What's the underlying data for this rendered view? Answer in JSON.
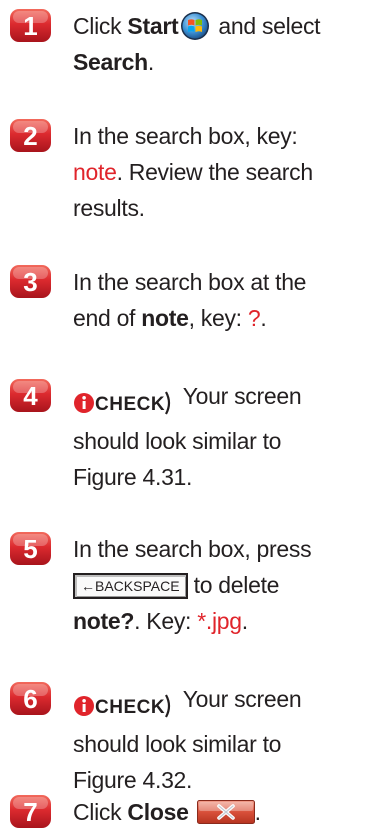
{
  "steps": [
    {
      "number": "1",
      "lines": [
        {
          "a": "Click ",
          "b": "Start",
          "c": " and select"
        },
        {
          "b": "Search",
          "c": "."
        }
      ]
    },
    {
      "number": "2",
      "lines": [
        {
          "a": "In the search box, key:"
        },
        {
          "red": "note",
          "c": ". Review the search"
        },
        {
          "a": "results."
        }
      ]
    },
    {
      "number": "3",
      "lines": [
        {
          "a": "In the search box at the"
        },
        {
          "a": "end of ",
          "b": "note",
          "c": ", key: ",
          "red": "?",
          "d": "."
        }
      ]
    },
    {
      "number": "4",
      "check_label": "CHECK",
      "lines": [
        {
          "a": " Your screen"
        },
        {
          "a": "should look similar to"
        },
        {
          "a": "Figure 4.31."
        }
      ]
    },
    {
      "number": "5",
      "key_label": "←BACKSPACE",
      "lines": [
        {
          "a": "In the search box, press"
        },
        {
          "a": " to delete"
        },
        {
          "b": "note?",
          "c": ". Key: ",
          "red": "*.jpg",
          "d": "."
        }
      ]
    },
    {
      "number": "6",
      "check_label": "CHECK",
      "lines": [
        {
          "a": " Your screen"
        },
        {
          "a": "should look similar to"
        },
        {
          "a": "Figure 4.32."
        }
      ]
    },
    {
      "number": "7",
      "lines": [
        {
          "a": "Click ",
          "b": "Close",
          "c": "."
        }
      ]
    }
  ],
  "colors": {
    "badge_red": "#d7262e",
    "highlight_red": "#e0242b",
    "text": "#231f20"
  },
  "icons": {
    "start": "windows-start-orb-icon",
    "check": "info-check-icon",
    "close": "close-x-button-icon"
  }
}
